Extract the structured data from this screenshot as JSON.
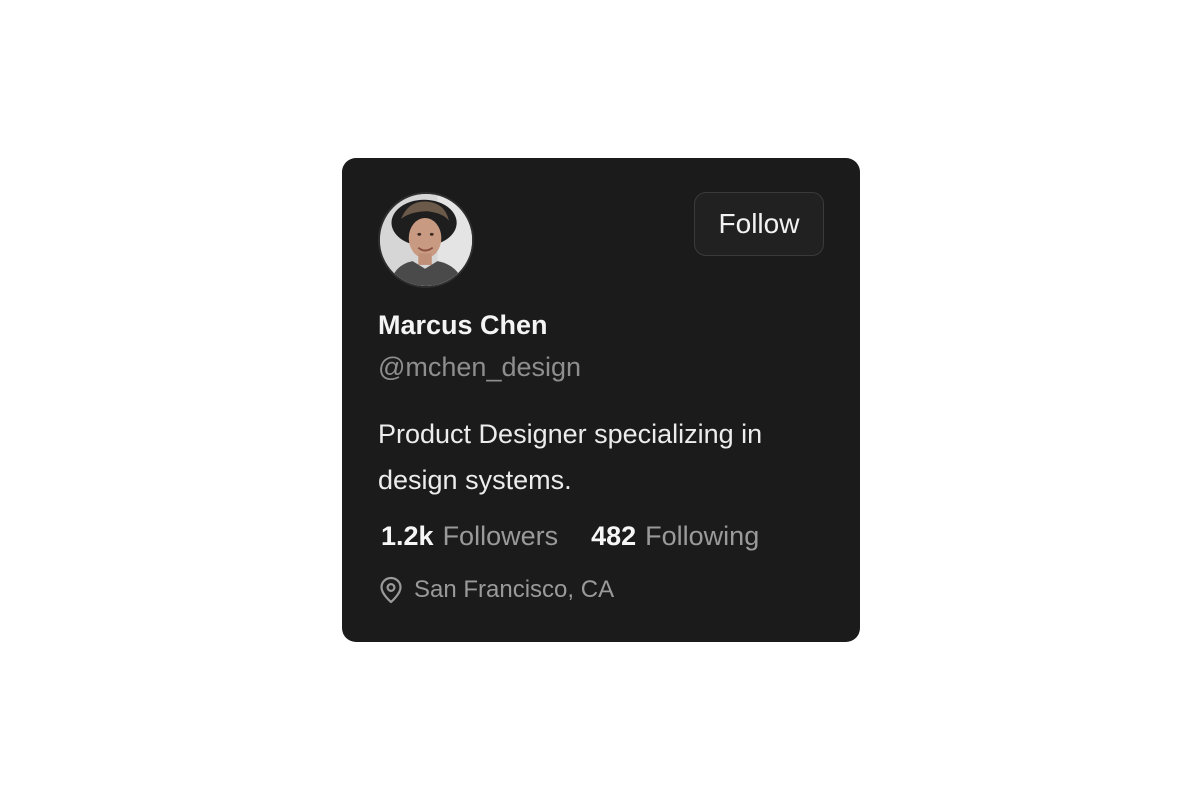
{
  "profile": {
    "name": "Marcus Chen",
    "handle": "@mchen_design",
    "bio": "Product Designer specializing in design systems.",
    "location": "San Francisco, CA",
    "avatar_icon": "avatar-photo"
  },
  "actions": {
    "follow_label": "Follow"
  },
  "stats": {
    "followers_value": "1.2k",
    "followers_label": "Followers",
    "following_value": "482",
    "following_label": "Following"
  },
  "icons": {
    "location": "map-pin-icon"
  },
  "colors": {
    "card_background": "#1b1b1b",
    "button_background": "#212121",
    "primary_text": "#f4f4f4",
    "secondary_text": "#8e8e8e"
  }
}
